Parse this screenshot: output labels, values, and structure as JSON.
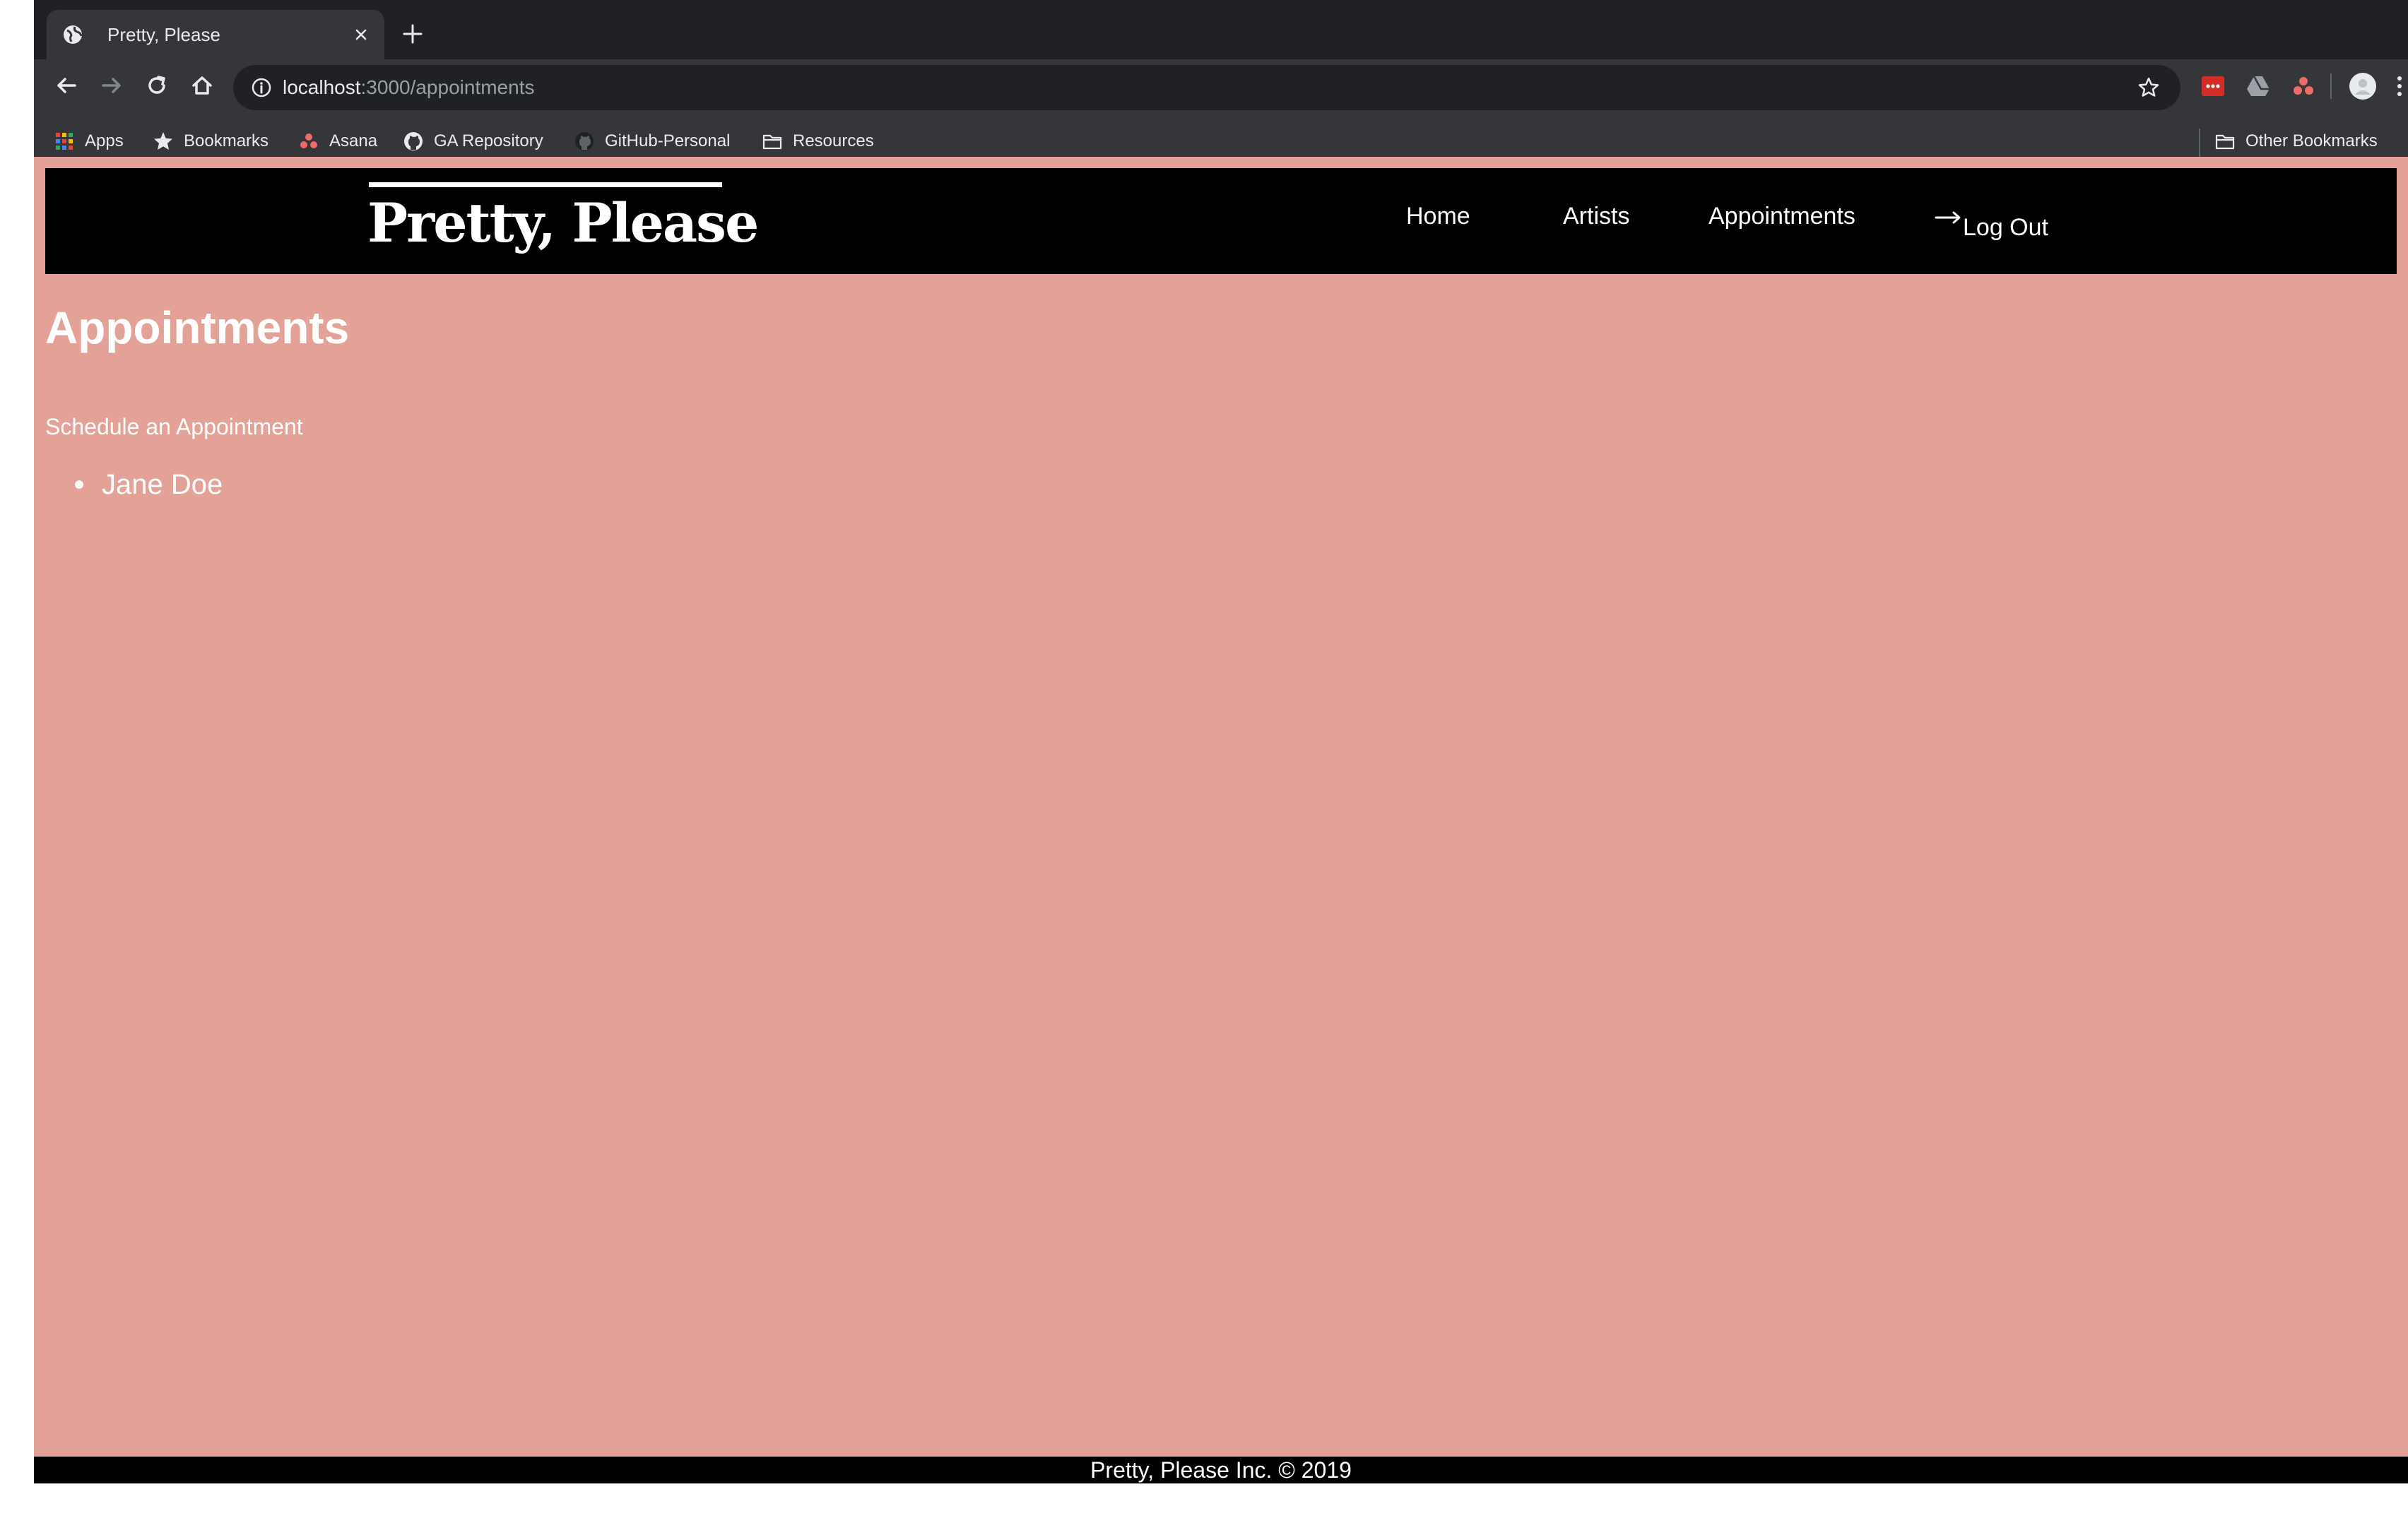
{
  "browser": {
    "tab": {
      "title": "Pretty, Please"
    },
    "address": {
      "host": "localhost",
      "path": ":3000/appointments"
    },
    "bookmarks": [
      {
        "label": "Apps",
        "icon": "apps-grid-icon"
      },
      {
        "label": "Bookmarks",
        "icon": "star-icon"
      },
      {
        "label": "Asana",
        "icon": "asana-icon"
      },
      {
        "label": "GA Repository",
        "icon": "github-icon"
      },
      {
        "label": "GitHub-Personal",
        "icon": "github-icon"
      },
      {
        "label": "Resources",
        "icon": "folder-icon"
      }
    ],
    "other_bookmarks": "Other Bookmarks"
  },
  "site": {
    "brand": "Pretty, Please",
    "nav": {
      "home": "Home",
      "artists": "Artists",
      "appointments": "Appointments",
      "logout": "Log Out"
    },
    "page_title": "Appointments",
    "schedule_link": "Schedule an Appointment",
    "appointments": [
      "Jane Doe"
    ],
    "footer": "Pretty, Please Inc. © 2019"
  },
  "colors": {
    "page_bg": "#e3a198",
    "nav_bg": "#000000",
    "text": "#ffffff",
    "chrome_dark": "#202124",
    "chrome_toolbar": "#35363a"
  }
}
